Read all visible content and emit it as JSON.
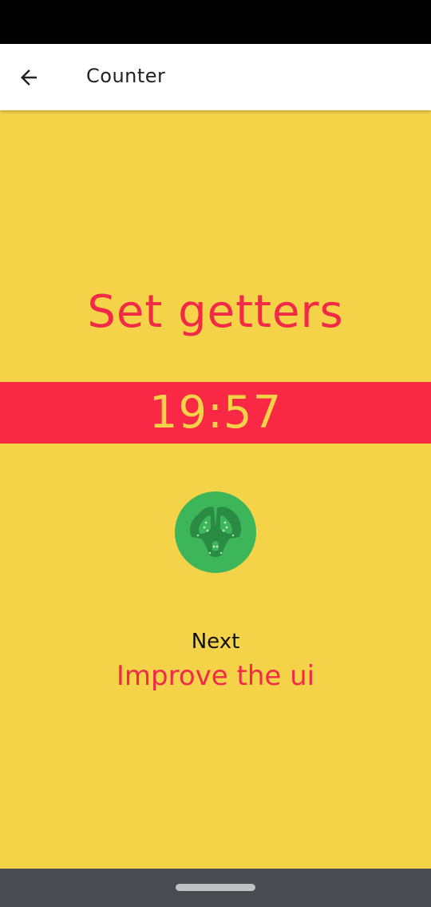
{
  "app_bar": {
    "title": "Counter",
    "back_icon": "arrow-left-icon"
  },
  "task": {
    "current": "Set getters"
  },
  "timer": {
    "display": "19:57"
  },
  "tomato_icon": "tomato-slice-icon",
  "next": {
    "label": "Next",
    "task": "Improve the ui"
  },
  "colors": {
    "background": "#F5D349",
    "accent_red": "#F92945",
    "task_text": "#F22A48",
    "tomato_green": "#3DB559",
    "tomato_dark": "#2A8C43"
  }
}
